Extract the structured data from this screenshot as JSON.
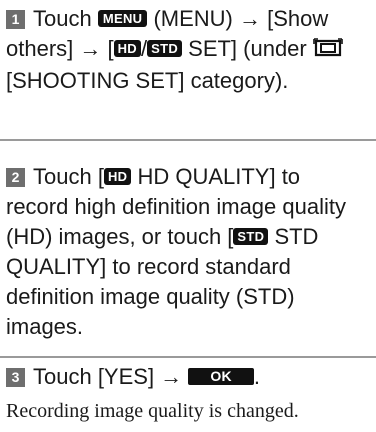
{
  "steps": [
    {
      "number": "1",
      "t1": "Touch",
      "menu_key": "MENU",
      "t2": "(MENU) → [Show others] → [",
      "hd_icon": "HD",
      "slash": "/",
      "std_icon": "STD",
      "t3": "SET] (under",
      "camera_icon": "camera-icon",
      "t4": "[SHOOTING SET] category)."
    },
    {
      "number": "2",
      "t1": "Touch [",
      "hd_icon": "HD",
      "t2": "HD QUALITY] to record high definition image quality (HD) images, or touch [",
      "std_icon": "STD",
      "t3": "STD QUALITY] to record standard definition image quality (STD) images."
    },
    {
      "number": "3",
      "t1": "Touch [YES] →",
      "ok_key": "OK",
      "t2": "."
    }
  ],
  "note": "Recording image quality is changed."
}
